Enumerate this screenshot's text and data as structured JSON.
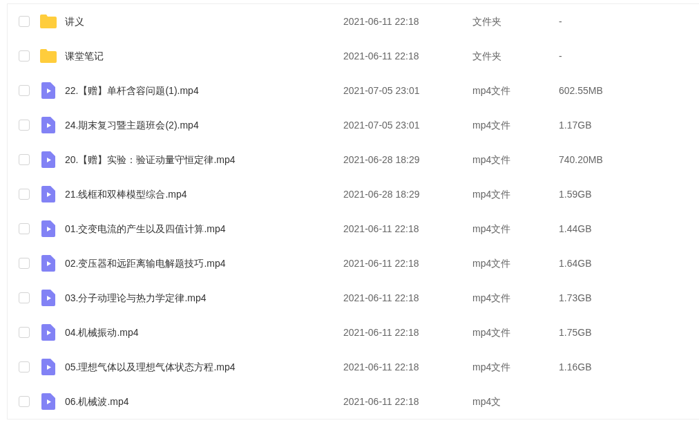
{
  "files": [
    {
      "kind": "folder",
      "name": "讲义",
      "modified": "2021-06-11 22:18",
      "type": "文件夹",
      "size": "-",
      "checked": false
    },
    {
      "kind": "folder",
      "name": "课堂笔记",
      "modified": "2021-06-11 22:18",
      "type": "文件夹",
      "size": "-",
      "checked": false
    },
    {
      "kind": "video",
      "name": "22.【赠】单杆含容问题(1).mp4",
      "modified": "2021-07-05 23:01",
      "type": "mp4文件",
      "size": "602.55MB",
      "checked": false
    },
    {
      "kind": "video",
      "name": "24.期末复习暨主题班会(2).mp4",
      "modified": "2021-07-05 23:01",
      "type": "mp4文件",
      "size": "1.17GB",
      "checked": false
    },
    {
      "kind": "video",
      "name": "20.【赠】实验：验证动量守恒定律.mp4",
      "modified": "2021-06-28 18:29",
      "type": "mp4文件",
      "size": "740.20MB",
      "checked": false
    },
    {
      "kind": "video",
      "name": "21.线框和双棒模型综合.mp4",
      "modified": "2021-06-28 18:29",
      "type": "mp4文件",
      "size": "1.59GB",
      "checked": false
    },
    {
      "kind": "video",
      "name": "01.交变电流的产生以及四值计算.mp4",
      "modified": "2021-06-11 22:18",
      "type": "mp4文件",
      "size": "1.44GB",
      "checked": false
    },
    {
      "kind": "video",
      "name": "02.变压器和远距离输电解题技巧.mp4",
      "modified": "2021-06-11 22:18",
      "type": "mp4文件",
      "size": "1.64GB",
      "checked": false
    },
    {
      "kind": "video",
      "name": "03.分子动理论与热力学定律.mp4",
      "modified": "2021-06-11 22:18",
      "type": "mp4文件",
      "size": "1.73GB",
      "checked": false
    },
    {
      "kind": "video",
      "name": "04.机械振动.mp4",
      "modified": "2021-06-11 22:18",
      "type": "mp4文件",
      "size": "1.75GB",
      "checked": false
    },
    {
      "kind": "video",
      "name": "05.理想气体以及理想气体状态方程.mp4",
      "modified": "2021-06-11 22:18",
      "type": "mp4文件",
      "size": "1.16GB",
      "checked": false
    },
    {
      "kind": "video",
      "name": "06.机械波.mp4",
      "modified": "2021-06-11 22:18",
      "type": "mp4文",
      "checked": false
    }
  ]
}
